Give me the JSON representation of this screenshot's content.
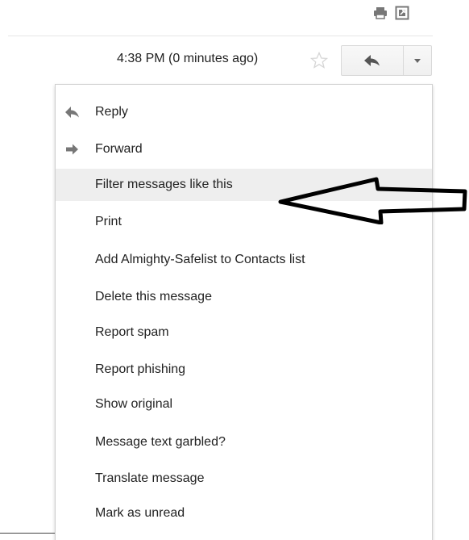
{
  "header": {
    "timestamp": "4:38 PM (0 minutes ago)",
    "print_icon": "print-icon",
    "popout_icon": "new-window-icon",
    "star_icon": "star-icon",
    "reply_icon": "reply-arrow-icon",
    "more_icon": "dropdown-caret-icon"
  },
  "menu": {
    "items": [
      {
        "label": "Reply",
        "icon": "reply-arrow-icon"
      },
      {
        "label": "Forward",
        "icon": "forward-arrow-icon"
      },
      {
        "label": "Filter messages like this",
        "highlighted": true
      },
      {
        "label": "Print"
      },
      {
        "label": "Add Almighty-Safelist to Contacts list"
      },
      {
        "label": "Delete this message"
      },
      {
        "label": "Report spam"
      },
      {
        "label": "Report phishing"
      },
      {
        "label": "Show original"
      },
      {
        "label": "Message text garbled?"
      },
      {
        "label": "Translate message"
      },
      {
        "label": "Mark as unread"
      }
    ]
  },
  "annotation": {
    "icon": "callout-arrow-pointing-left",
    "color": "#000000"
  },
  "colors": {
    "highlight_bg": "#eeeeee",
    "icon_gray": "#666666",
    "star_outline": "#d6d6d6"
  }
}
